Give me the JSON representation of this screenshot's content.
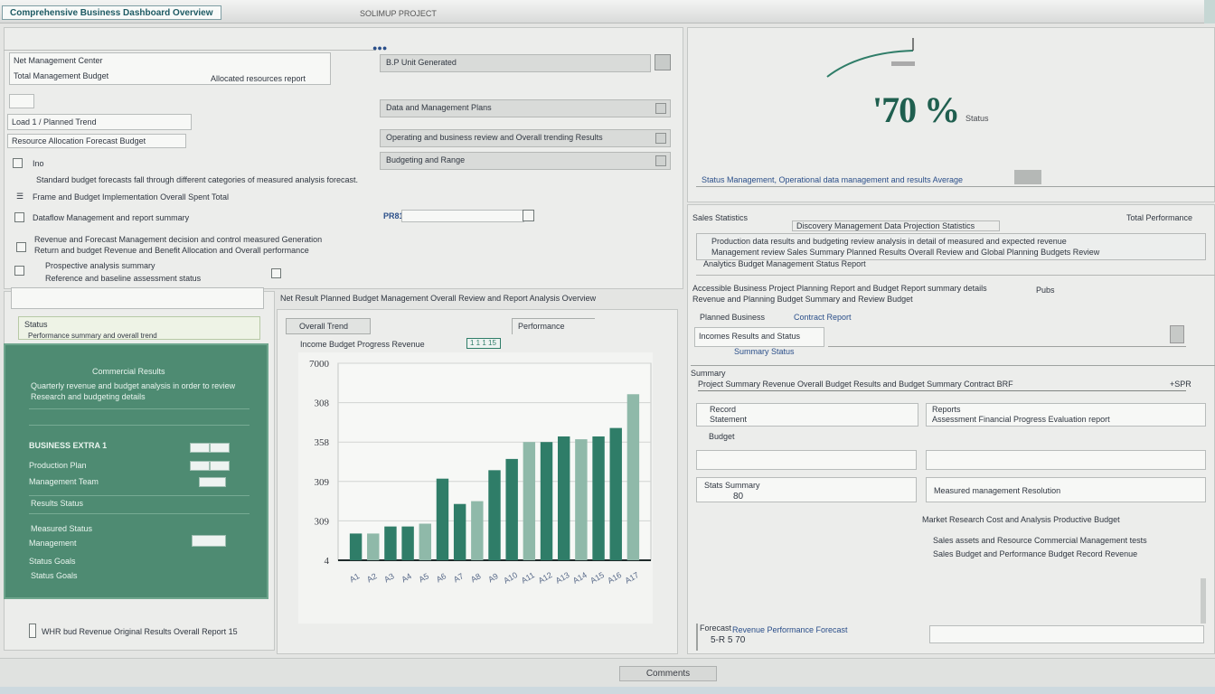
{
  "window": {
    "title": "Comprehensive Business Dashboard Overview",
    "subtitle": "SOLIMUP PROJECT"
  },
  "left_panel": {
    "field1": "Net Management Center",
    "field2_label": "Total Management Budget",
    "field2_note": "Allocated resources report",
    "field3_value": "Load 1 / Planned Trend",
    "field4_value": "Resource Allocation Forecast Budget",
    "checkbox1_label": "Ino",
    "para1": "Standard budget forecasts fall through different categories of measured analysis forecast.",
    "line2": "Frame and Budget Implementation Overall Spent Total",
    "line3": "Dataflow Management and report summary",
    "line4": "Revenue and Forecast Management decision and control measured Generation",
    "line5": "Return and budget Revenue and Benefit Allocation and Overall performance",
    "line6": "Prospective analysis summary",
    "line7": "Reference and baseline assessment status"
  },
  "mid_form": {
    "field1": "B.P Unit Generated",
    "field2": "Data and Management Plans",
    "field3": "Operating and business review and Overall trending Results",
    "field4": "Budgeting and Range",
    "value_label": "PR81"
  },
  "green_panel": {
    "title": "Commercial Results",
    "line1": "Quarterly revenue and budget analysis in order to review",
    "line2": "Research and budgeting details",
    "row1": "BUSINESS EXTRA 1",
    "row2": "Production Plan",
    "row3": "Management Team",
    "row4": "Results Status",
    "row5": "Measured Status",
    "row6": "Management",
    "row7": "Status Goals"
  },
  "left_bottom": {
    "header_box": "Status",
    "header_sub": "Performance summary and overall trend",
    "footer": "WHR bud Revenue Original Results Overall Report 15"
  },
  "chart_area": {
    "top_text": "Net Result Planned Budget Management Overall Review and Report Analysis Overview",
    "tab1": "Overall Trend",
    "tab2": "Performance",
    "legend": "Income Budget Progress Revenue",
    "legend_badge": "1 1 1 15"
  },
  "chart_data": {
    "type": "bar",
    "ylim": [
      0,
      700
    ],
    "yticks": [
      "4",
      "309",
      "309",
      "358",
      "308",
      "7000"
    ],
    "categories": [
      "A1",
      "A2",
      "A3",
      "A4",
      "A5",
      "A6",
      "A7",
      "A8",
      "A9",
      "A10",
      "A11",
      "A12",
      "A13",
      "A14",
      "A15",
      "A16",
      "A17"
    ],
    "series": [
      {
        "values": [
          95,
          95,
          120,
          120,
          130,
          290,
          200,
          210,
          320,
          360,
          420,
          420,
          440,
          430,
          440,
          470,
          590
        ]
      }
    ],
    "colors": {
      "bar": "#2f7d68",
      "bar_light": "#8fb9a9"
    }
  },
  "right_top": {
    "gauge_value": "'70 %",
    "gauge_unit": "Status",
    "summary_line": "Status Management, Operational data management and results Average"
  },
  "right_panel": {
    "header_left": "Sales Statistics",
    "header_right": "Total Performance",
    "sub_header": "Discovery Management Data Projection Statistics",
    "para1": "Production data results and budgeting review analysis in detail of measured and expected revenue",
    "para2": "Management review Sales Summary Planned Results Overall Review and Global Planning Budgets Review",
    "para3": "Analytics Budget Management Status Report",
    "section1": "Accessible Business Project Planning Report and Budget Report summary details",
    "section1_extra": "Pubs",
    "section1_line2": "Revenue and Planning Budget Summary and Review Budget",
    "section2_left": "Planned Business",
    "section2_right": "Contract Report",
    "section2_field": "Incomes Results and Status",
    "section2_note": "Summary Status",
    "section3_title": "Summary",
    "section3_line": "Project Summary Revenue Overall Budget Results and Budget Summary Contract BRF",
    "section3_badge": "+SPR",
    "col1_head": "Record",
    "col1_sub": "Statement",
    "col2_head": "Reports",
    "col2_sub": "Assessment Financial Progress Evaluation report",
    "field_label": "Budget",
    "stat_label": "Stats Summary",
    "stat_value": "80",
    "stat_right": "Measured management Resolution",
    "note1": "Market Research Cost and Analysis Productive Budget",
    "note2": "Sales assets and Resource Commercial Management tests",
    "note3": "Sales Budget and Performance Budget Record Revenue",
    "bottom_label": "Forecast",
    "bottom_link": "Revenue Performance Forecast",
    "bottom_value": "5-R 5 70"
  },
  "footer": {
    "button": "Comments"
  }
}
